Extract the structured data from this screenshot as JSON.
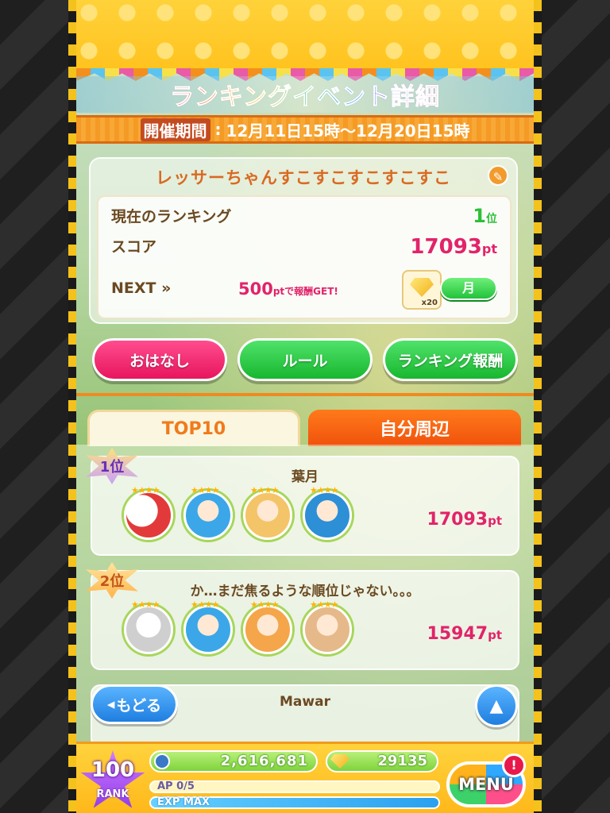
{
  "event": {
    "title": "ランキングイベント詳細",
    "period_label": "開催期間",
    "period_value": "12月11日15時〜12月20日15時"
  },
  "player_panel": {
    "name": "レッサーちゃんすこすこすこすこすこ",
    "current_ranking_label": "現在のランキング",
    "current_ranking_value": "1",
    "ranking_suffix": "位",
    "score_label": "スコア",
    "score_value": "17093",
    "score_unit": "pt",
    "next_label": "NEXT »",
    "next_points": "500",
    "next_points_suffix": "ptで報酬GET!",
    "next_reward_qty": "x20",
    "next_reward_button": "月"
  },
  "buttons": {
    "talk": "おはなし",
    "rules": "ルール",
    "ranking_reward": "ランキング報酬"
  },
  "tabs": {
    "top10": "TOP10",
    "around_me": "自分周辺"
  },
  "ranking": [
    {
      "rank": "1位",
      "name": "葉月",
      "score": "17093",
      "unit": "pt"
    },
    {
      "rank": "2位",
      "name": "か…まだ焦るような順位じゃない。。。",
      "score": "15947",
      "unit": "pt"
    },
    {
      "rank": "",
      "name": "Mawar",
      "score": "",
      "unit": ""
    }
  ],
  "navigation": {
    "back": "もどる",
    "up": "▲"
  },
  "status": {
    "rank_value": "100",
    "rank_label": "RANK",
    "coins": "2,616,681",
    "gems": "29135",
    "ap_label": "AP 0/5",
    "exp_label": "EXP MAX",
    "menu_label": "MENU",
    "alert": "!"
  },
  "colors": {
    "accent_orange": "#f07a1c",
    "score_pink": "#e2236a",
    "rank_green": "#2dbf38"
  }
}
